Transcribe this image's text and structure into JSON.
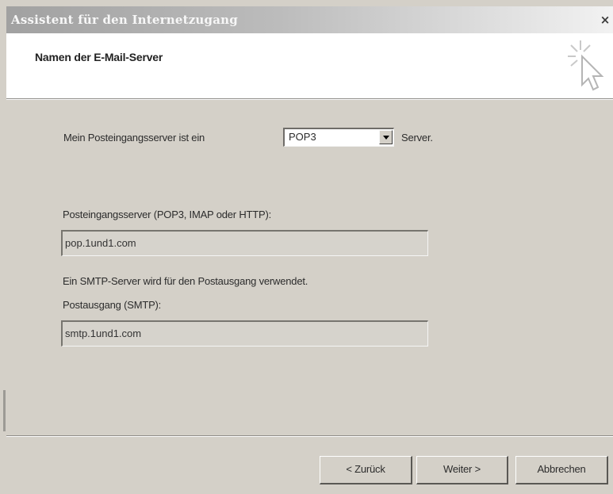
{
  "window": {
    "title": "Assistent für den Internetzugang",
    "close_label": "×"
  },
  "header": {
    "title": "Namen der E-Mail-Server",
    "icon": "wizard-cursor-icon"
  },
  "incoming_type": {
    "label_prefix": "Mein Posteingangsserver ist ein",
    "selected": "POP3",
    "label_suffix": "Server."
  },
  "incoming_server": {
    "label": "Posteingangsserver (POP3, IMAP oder HTTP):",
    "value": "pop.1und1.com"
  },
  "outgoing_server": {
    "info": "Ein SMTP-Server wird für den Postausgang verwendet.",
    "label": "Postausgang (SMTP):",
    "value": "smtp.1und1.com"
  },
  "buttons": {
    "back": "< Zurück",
    "next": "Weiter >",
    "cancel": "Abbrechen"
  }
}
